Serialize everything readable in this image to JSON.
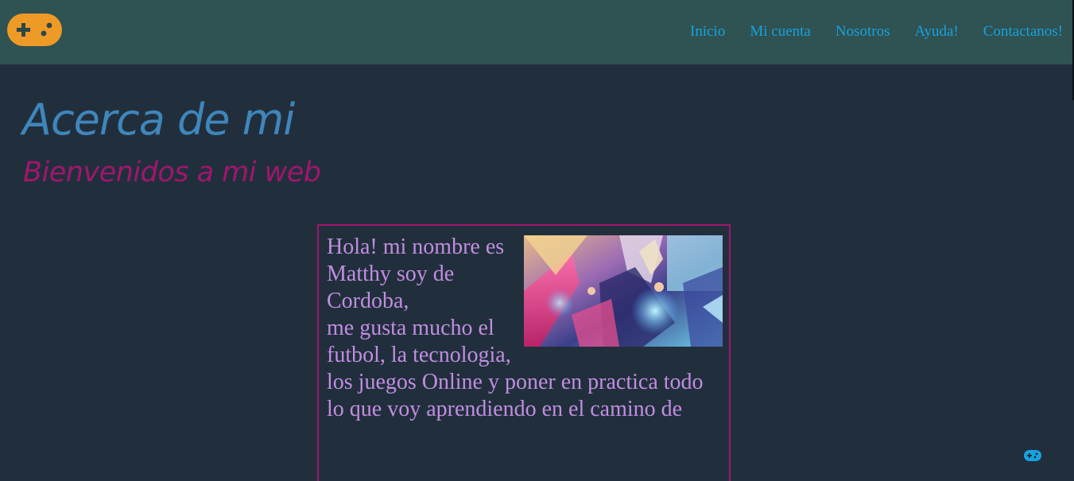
{
  "colors": {
    "navbar_bg": "#2f5252",
    "page_bg": "#212f3d",
    "logo_orange": "#ee9a27",
    "nav_link": "#17a2e0",
    "title": "#3f86bb",
    "subtitle": "#a1166d",
    "body_text": "#c18ee0",
    "box_border": "#a1166d"
  },
  "navbar": {
    "logo_icon": "gamepad-icon",
    "links": [
      "Inicio",
      "Mi cuenta",
      "Nosotros",
      "Ayuda!",
      "Contactanos!"
    ]
  },
  "main": {
    "title": "Acerca de mi",
    "subtitle": "Bienvenidos a mi web",
    "about": {
      "image": "game-splash-art",
      "lines": [
        "Hola! mi nombre es Matthy soy de Cordoba,",
        "me gusta mucho el futbol, la tecnologia,",
        "los juegos Online y poner en practica todo",
        "lo que voy aprendiendo en el camino de"
      ]
    }
  },
  "floating_icon": "gamepad-icon"
}
